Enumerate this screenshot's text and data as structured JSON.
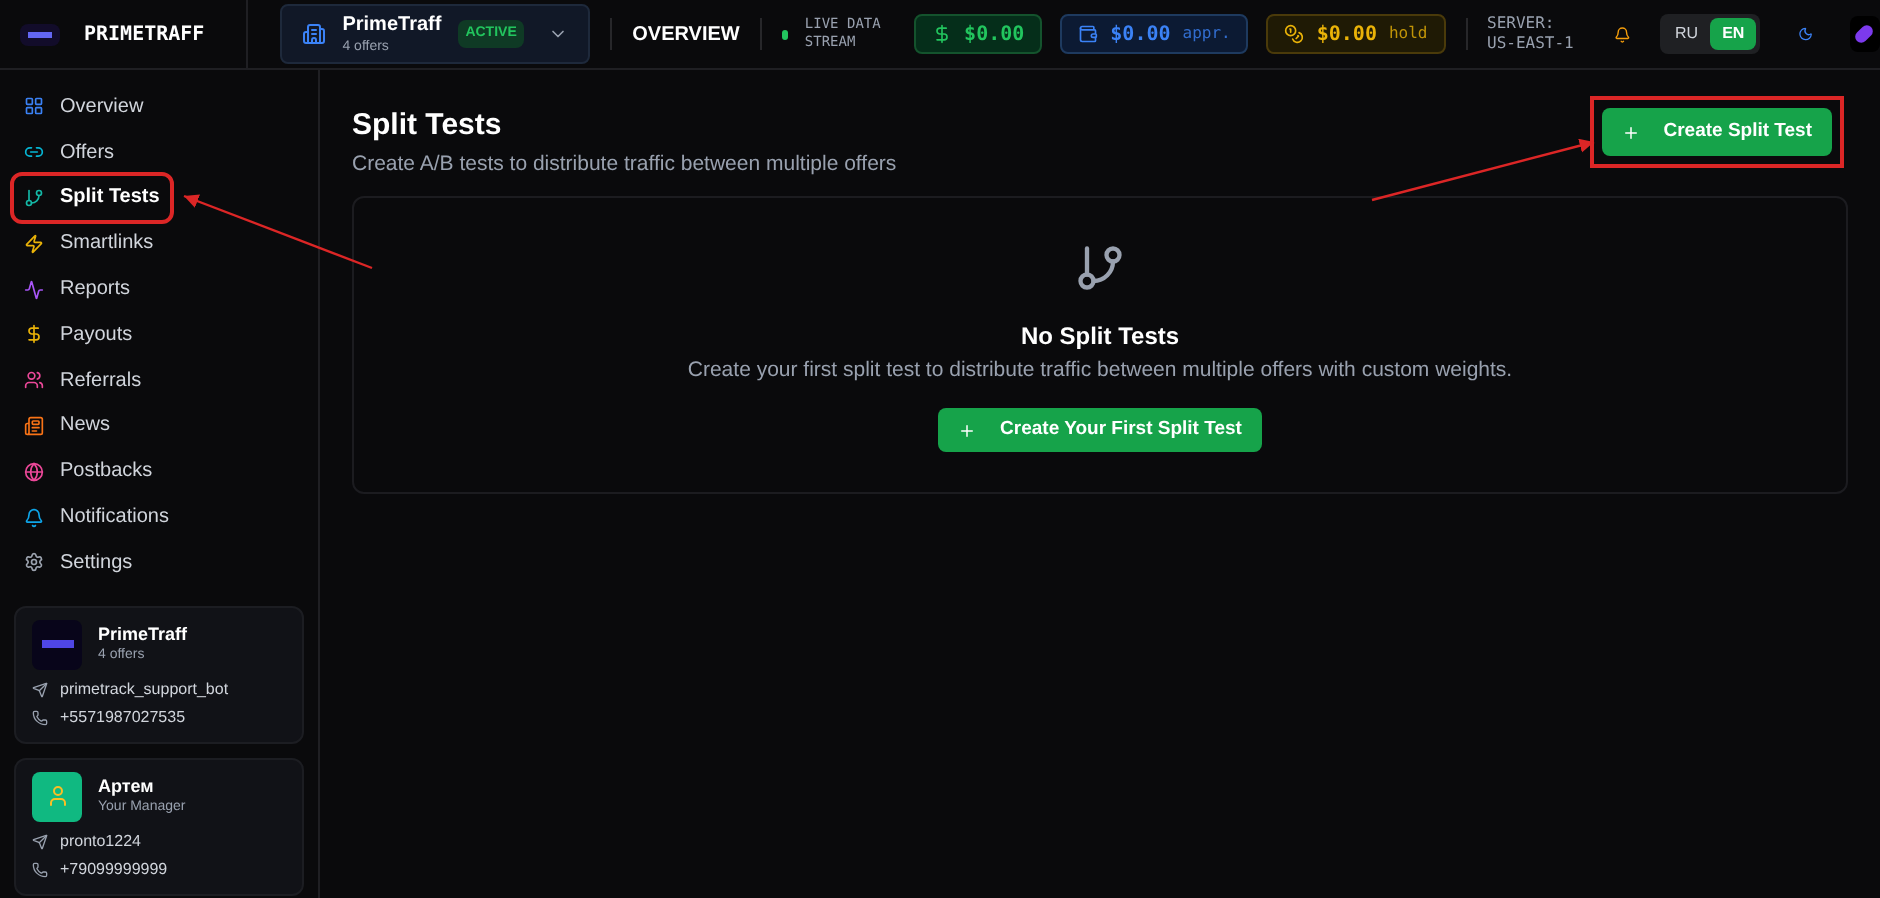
{
  "header": {
    "brand": "PRIMETRAFF",
    "account": {
      "name": "PrimeTraff",
      "subtitle": "4 offers",
      "badge": "ACTIVE"
    },
    "page": "OVERVIEW",
    "live": "LIVE DATA STREAM",
    "balances": [
      {
        "kind": "available",
        "amount": "$0.00"
      },
      {
        "kind": "approved",
        "amount": "$0.00",
        "note": "appr."
      },
      {
        "kind": "hold",
        "amount": "$0.00",
        "note": "hold"
      }
    ],
    "server": "SERVER: US-EAST-1",
    "languages": [
      {
        "label": "RU",
        "selected": false
      },
      {
        "label": "EN",
        "selected": true
      }
    ]
  },
  "sidebar": {
    "items": [
      {
        "label": "Overview",
        "selected": false,
        "highlighted": false
      },
      {
        "label": "Offers",
        "selected": false,
        "highlighted": false
      },
      {
        "label": "Split Tests",
        "selected": true,
        "highlighted": true
      },
      {
        "label": "Smartlinks",
        "selected": false,
        "highlighted": false
      },
      {
        "label": "Reports",
        "selected": false,
        "highlighted": false
      },
      {
        "label": "Payouts",
        "selected": false,
        "highlighted": false
      },
      {
        "label": "Referrals",
        "selected": false,
        "highlighted": false
      },
      {
        "label": "News",
        "selected": false,
        "highlighted": false
      },
      {
        "label": "Postbacks",
        "selected": false,
        "highlighted": false
      },
      {
        "label": "Notifications",
        "selected": false,
        "highlighted": false
      },
      {
        "label": "Settings",
        "selected": false,
        "highlighted": false
      }
    ],
    "cards": [
      {
        "kind": "brand",
        "name": "PrimeTraff",
        "subtitle": "4 offers",
        "telegram": "primetrack_support_bot",
        "phone": "+5571987027535"
      },
      {
        "kind": "manager",
        "name": "Артем",
        "subtitle": "Your Manager",
        "telegram": "pronto1224",
        "phone": "+79099999999"
      }
    ]
  },
  "main": {
    "title": "Split Tests",
    "subtitle": "Create A/B tests to distribute traffic between multiple offers",
    "create_button": {
      "label": "Create Split Test",
      "highlighted": true
    },
    "empty": {
      "title": "No Split Tests",
      "text": "Create your first split test to distribute traffic between multiple offers with custom weights.",
      "button": "Create Your First Split Test"
    }
  }
}
